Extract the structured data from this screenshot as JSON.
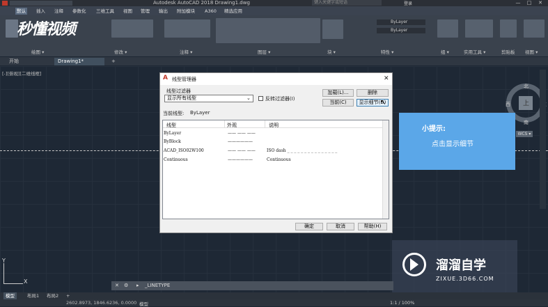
{
  "window": {
    "title": "Autodesk AutoCAD 2018    Drawing1.dwg",
    "search_placeholder": "键入关键字或短语",
    "login_label": "登录",
    "controls": [
      "—",
      "□",
      "✕"
    ]
  },
  "menu": {
    "tabs": [
      "默认",
      "插入",
      "注释",
      "参数化",
      "三维工具",
      "视图",
      "管理",
      "输出",
      "附加模块",
      "A360",
      "精选应用"
    ],
    "active": "默认"
  },
  "ribbon": {
    "panels": [
      "绘图 ▾",
      "修改 ▾",
      "注释 ▾",
      "图层 ▾",
      "块 ▾",
      "特性 ▾",
      "组 ▾",
      "实用工具 ▾",
      "剪贴板",
      "视图 ▾"
    ],
    "bylayer_1": "ByLayer",
    "bylayer_2": "ByLayer",
    "watermark_brand": "秒懂视频"
  },
  "doc_tabs": {
    "start": "开始",
    "drawing": "Drawing1*",
    "add": "+"
  },
  "canvas": {
    "view_label": "[-][俯视][二维线框]",
    "compass": {
      "north": "北",
      "south": "南",
      "east": "东",
      "west": "西",
      "center": "上",
      "wcs": "WCS ▾"
    },
    "ucs_x": "X",
    "ucs_y": "Y"
  },
  "dialog": {
    "title": "线型管理器",
    "filter_label": "线型过滤器",
    "filter_value": "显示所有线型",
    "invert_label": "反转过滤器(I)",
    "buttons": {
      "load": "加载(L)...",
      "delete": "删除",
      "current": "当前(C)",
      "show_details": "显示细节(D)",
      "ok": "确定",
      "cancel": "取消",
      "help": "帮助(H)"
    },
    "current_linetype_label": "当前线型:",
    "current_linetype_value": "ByLayer",
    "columns": [
      "线型",
      "外观",
      "说明"
    ],
    "rows": [
      {
        "name": "ByLayer",
        "appearance": "—— —— ——",
        "desc": ""
      },
      {
        "name": "ByBlock",
        "appearance": "——————",
        "desc": ""
      },
      {
        "name": "ACAD_ISO02W100",
        "appearance": "—— —— ——",
        "desc": "ISO dash _ _ _ _ _ _ _ _ _ _ _ _ _ _ _"
      },
      {
        "name": "Continuous",
        "appearance": "——————",
        "desc": "Continuous"
      }
    ]
  },
  "tip": {
    "title": "小提示:",
    "body": "点击显示细节"
  },
  "watermark": {
    "name": "溜溜自学",
    "url": "ZIXUE.3D66.COM"
  },
  "command": {
    "text": "_LINETYPE",
    "prompt": "▸"
  },
  "layout_tabs": [
    "模型",
    "布局1",
    "布局2",
    "+"
  ],
  "status": {
    "coords": "2602.8973, 1846.6236, 0.0000",
    "model": "模型",
    "scale": "1:1 / 100%"
  },
  "colors": {
    "accent": "#5ba7e8",
    "canvas": "#1e2835",
    "ribbon": "#3a424d"
  }
}
